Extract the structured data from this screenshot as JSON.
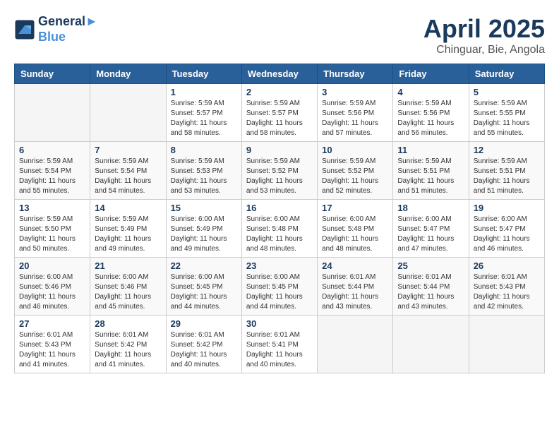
{
  "header": {
    "logo_line1": "General",
    "logo_line2": "Blue",
    "month_title": "April 2025",
    "subtitle": "Chinguar, Bie, Angola"
  },
  "days_of_week": [
    "Sunday",
    "Monday",
    "Tuesday",
    "Wednesday",
    "Thursday",
    "Friday",
    "Saturday"
  ],
  "weeks": [
    [
      {
        "day": "",
        "info": ""
      },
      {
        "day": "",
        "info": ""
      },
      {
        "day": "1",
        "info": "Sunrise: 5:59 AM\nSunset: 5:57 PM\nDaylight: 11 hours and 58 minutes."
      },
      {
        "day": "2",
        "info": "Sunrise: 5:59 AM\nSunset: 5:57 PM\nDaylight: 11 hours and 58 minutes."
      },
      {
        "day": "3",
        "info": "Sunrise: 5:59 AM\nSunset: 5:56 PM\nDaylight: 11 hours and 57 minutes."
      },
      {
        "day": "4",
        "info": "Sunrise: 5:59 AM\nSunset: 5:56 PM\nDaylight: 11 hours and 56 minutes."
      },
      {
        "day": "5",
        "info": "Sunrise: 5:59 AM\nSunset: 5:55 PM\nDaylight: 11 hours and 55 minutes."
      }
    ],
    [
      {
        "day": "6",
        "info": "Sunrise: 5:59 AM\nSunset: 5:54 PM\nDaylight: 11 hours and 55 minutes."
      },
      {
        "day": "7",
        "info": "Sunrise: 5:59 AM\nSunset: 5:54 PM\nDaylight: 11 hours and 54 minutes."
      },
      {
        "day": "8",
        "info": "Sunrise: 5:59 AM\nSunset: 5:53 PM\nDaylight: 11 hours and 53 minutes."
      },
      {
        "day": "9",
        "info": "Sunrise: 5:59 AM\nSunset: 5:52 PM\nDaylight: 11 hours and 53 minutes."
      },
      {
        "day": "10",
        "info": "Sunrise: 5:59 AM\nSunset: 5:52 PM\nDaylight: 11 hours and 52 minutes."
      },
      {
        "day": "11",
        "info": "Sunrise: 5:59 AM\nSunset: 5:51 PM\nDaylight: 11 hours and 51 minutes."
      },
      {
        "day": "12",
        "info": "Sunrise: 5:59 AM\nSunset: 5:51 PM\nDaylight: 11 hours and 51 minutes."
      }
    ],
    [
      {
        "day": "13",
        "info": "Sunrise: 5:59 AM\nSunset: 5:50 PM\nDaylight: 11 hours and 50 minutes."
      },
      {
        "day": "14",
        "info": "Sunrise: 5:59 AM\nSunset: 5:49 PM\nDaylight: 11 hours and 49 minutes."
      },
      {
        "day": "15",
        "info": "Sunrise: 6:00 AM\nSunset: 5:49 PM\nDaylight: 11 hours and 49 minutes."
      },
      {
        "day": "16",
        "info": "Sunrise: 6:00 AM\nSunset: 5:48 PM\nDaylight: 11 hours and 48 minutes."
      },
      {
        "day": "17",
        "info": "Sunrise: 6:00 AM\nSunset: 5:48 PM\nDaylight: 11 hours and 48 minutes."
      },
      {
        "day": "18",
        "info": "Sunrise: 6:00 AM\nSunset: 5:47 PM\nDaylight: 11 hours and 47 minutes."
      },
      {
        "day": "19",
        "info": "Sunrise: 6:00 AM\nSunset: 5:47 PM\nDaylight: 11 hours and 46 minutes."
      }
    ],
    [
      {
        "day": "20",
        "info": "Sunrise: 6:00 AM\nSunset: 5:46 PM\nDaylight: 11 hours and 46 minutes."
      },
      {
        "day": "21",
        "info": "Sunrise: 6:00 AM\nSunset: 5:46 PM\nDaylight: 11 hours and 45 minutes."
      },
      {
        "day": "22",
        "info": "Sunrise: 6:00 AM\nSunset: 5:45 PM\nDaylight: 11 hours and 44 minutes."
      },
      {
        "day": "23",
        "info": "Sunrise: 6:00 AM\nSunset: 5:45 PM\nDaylight: 11 hours and 44 minutes."
      },
      {
        "day": "24",
        "info": "Sunrise: 6:01 AM\nSunset: 5:44 PM\nDaylight: 11 hours and 43 minutes."
      },
      {
        "day": "25",
        "info": "Sunrise: 6:01 AM\nSunset: 5:44 PM\nDaylight: 11 hours and 43 minutes."
      },
      {
        "day": "26",
        "info": "Sunrise: 6:01 AM\nSunset: 5:43 PM\nDaylight: 11 hours and 42 minutes."
      }
    ],
    [
      {
        "day": "27",
        "info": "Sunrise: 6:01 AM\nSunset: 5:43 PM\nDaylight: 11 hours and 41 minutes."
      },
      {
        "day": "28",
        "info": "Sunrise: 6:01 AM\nSunset: 5:42 PM\nDaylight: 11 hours and 41 minutes."
      },
      {
        "day": "29",
        "info": "Sunrise: 6:01 AM\nSunset: 5:42 PM\nDaylight: 11 hours and 40 minutes."
      },
      {
        "day": "30",
        "info": "Sunrise: 6:01 AM\nSunset: 5:41 PM\nDaylight: 11 hours and 40 minutes."
      },
      {
        "day": "",
        "info": ""
      },
      {
        "day": "",
        "info": ""
      },
      {
        "day": "",
        "info": ""
      }
    ]
  ]
}
